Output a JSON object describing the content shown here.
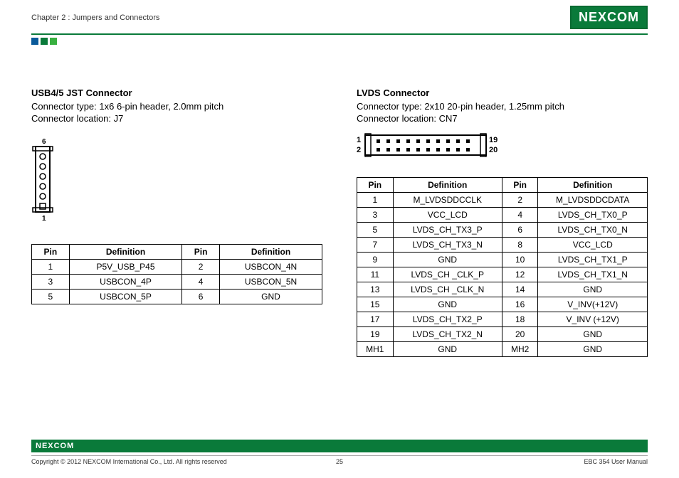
{
  "header": {
    "chapter": "Chapter 2 : Jumpers and Connectors",
    "logo": "NEXCOM"
  },
  "left": {
    "title": "USB4/5 JST Connector",
    "type": "Connector type: 1x6 6-pin header, 2.0mm pitch",
    "location": "Connector location: J7",
    "pin_label_top": "6",
    "pin_label_bottom": "1",
    "table": {
      "headers": [
        "Pin",
        "Definition",
        "Pin",
        "Definition"
      ],
      "rows": [
        [
          "1",
          "P5V_USB_P45",
          "2",
          "USBCON_4N"
        ],
        [
          "3",
          "USBCON_4P",
          "4",
          "USBCON_5N"
        ],
        [
          "5",
          "USBCON_5P",
          "6",
          "GND"
        ]
      ]
    }
  },
  "right": {
    "title": "LVDS Connector",
    "type": "Connector type: 2x10 20-pin header, 1.25mm pitch",
    "location": "Connector location: CN7",
    "pin_labels": {
      "tl": "1",
      "bl": "2",
      "tr": "19",
      "br": "20"
    },
    "table": {
      "headers": [
        "Pin",
        "Definition",
        "Pin",
        "Definition"
      ],
      "rows": [
        [
          "1",
          "M_LVDSDDCCLK",
          "2",
          "M_LVDSDDCDATA"
        ],
        [
          "3",
          "VCC_LCD",
          "4",
          "LVDS_CH_TX0_P"
        ],
        [
          "5",
          "LVDS_CH_TX3_P",
          "6",
          "LVDS_CH_TX0_N"
        ],
        [
          "7",
          "LVDS_CH_TX3_N",
          "8",
          "VCC_LCD"
        ],
        [
          "9",
          "GND",
          "10",
          "LVDS_CH_TX1_P"
        ],
        [
          "11",
          "LVDS_CH _CLK_P",
          "12",
          "LVDS_CH_TX1_N"
        ],
        [
          "13",
          "LVDS_CH _CLK_N",
          "14",
          "GND"
        ],
        [
          "15",
          "GND",
          "16",
          "V_INV(+12V)"
        ],
        [
          "17",
          "LVDS_CH_TX2_P",
          "18",
          "V_INV (+12V)"
        ],
        [
          "19",
          "LVDS_CH_TX2_N",
          "20",
          "GND"
        ],
        [
          "MH1",
          "GND",
          "MH2",
          "GND"
        ]
      ]
    }
  },
  "footer": {
    "logo": "NEXCOM",
    "copyright": "Copyright © 2012 NEXCOM International Co., Ltd. All rights reserved",
    "page": "25",
    "manual": "EBC 354 User Manual"
  }
}
